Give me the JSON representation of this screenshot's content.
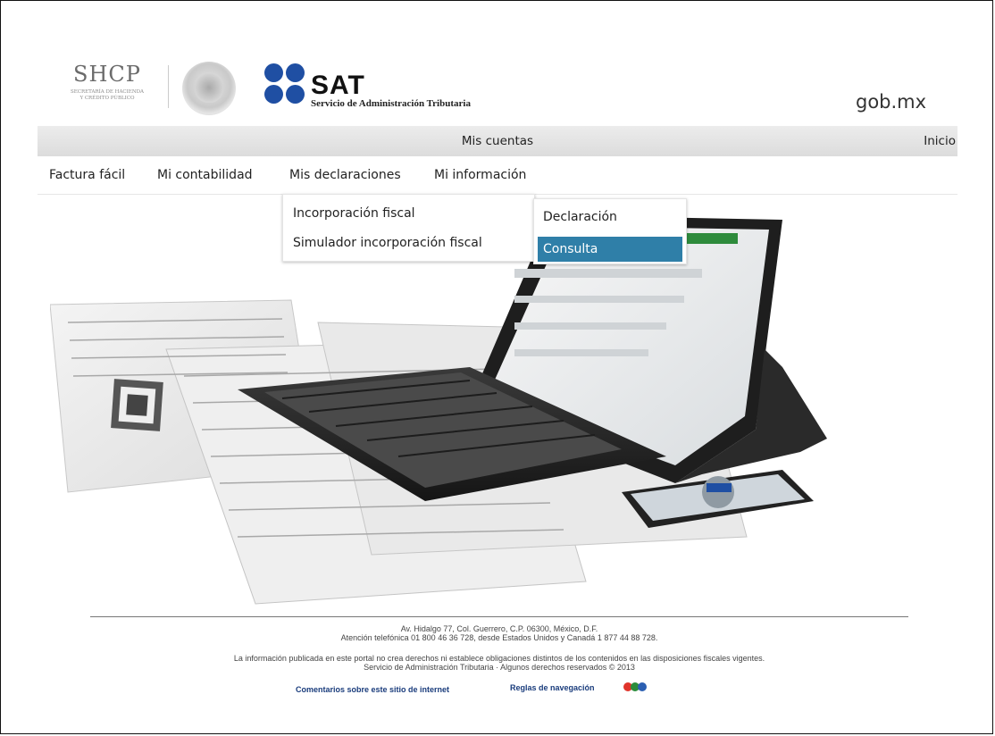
{
  "header": {
    "shcp_logo": "SHCP",
    "shcp_subtitle": "SECRETARÍA DE HACIENDA\nY CRÉDITO PÚBLICO",
    "sat_logo": "SAT",
    "sat_subtitle": "Servicio de Administración Tributaria",
    "gob_logo": "gob.mx"
  },
  "topbar": {
    "section": "Mis cuentas",
    "home": "Inicio"
  },
  "menu": {
    "items": [
      "Factura fácil",
      "Mi contabilidad",
      "Mis declaraciones",
      "Mi información"
    ]
  },
  "dropdown": {
    "items": [
      "Incorporación fiscal",
      "Simulador incorporación fiscal"
    ]
  },
  "submenu": {
    "items": [
      "Declaración",
      "Consulta"
    ],
    "active": "Consulta"
  },
  "footer": {
    "address": "Av. Hidalgo 77, Col. Guerrero, C.P. 06300, México, D.F.",
    "phone": "Atención telefónica 01 800 46 36 728, desde Estados Unidos y Canadá 1 877 44 88 728.",
    "disclaimer": "La información publicada en este portal no crea derechos ni establece obligaciones distintos de los contenidos en las disposiciones fiscales vigentes.",
    "copyright": "Servicio de Administración Tributaria · Algunos derechos reservados © 2013",
    "link_comments": "Comentarios sobre este sitio de internet",
    "link_rules": "Reglas de navegación"
  },
  "colors": {
    "sat_blue": "#1f4fa3",
    "active_item": "#2f7fa8",
    "footer_link": "#1a3c7c"
  }
}
